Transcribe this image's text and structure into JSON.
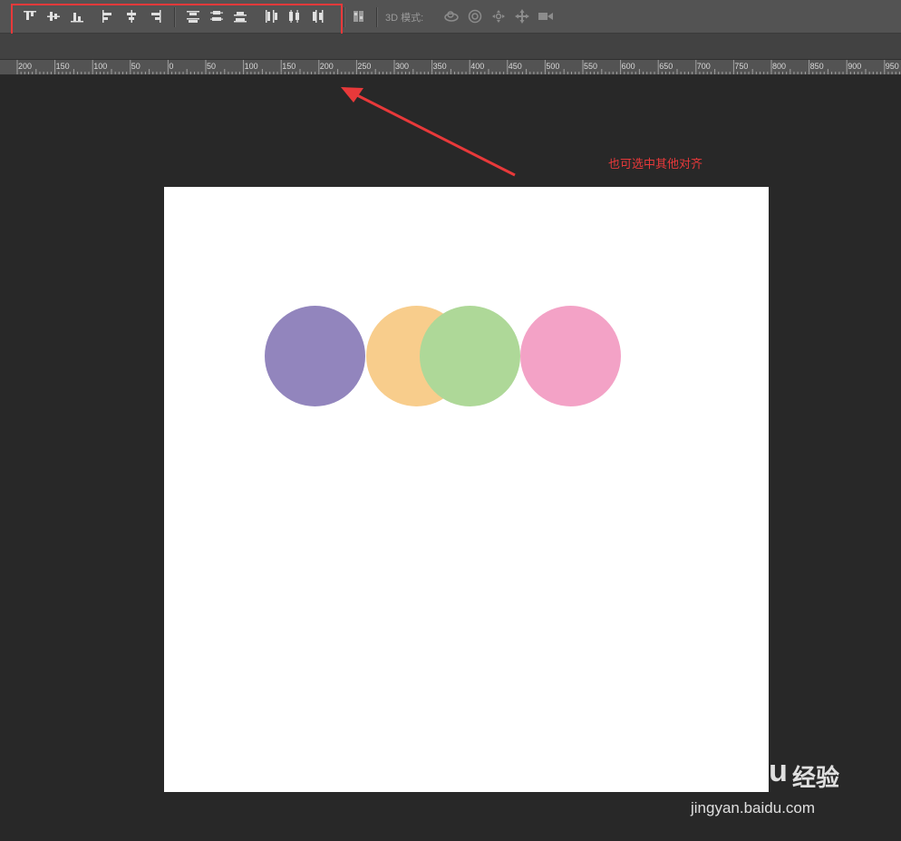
{
  "options_bar": {
    "align_buttons": [
      {
        "name": "align-top-edges-icon"
      },
      {
        "name": "align-vertical-centers-icon"
      },
      {
        "name": "align-bottom-edges-icon"
      },
      {
        "name": "align-left-edges-icon"
      },
      {
        "name": "align-horizontal-centers-icon"
      },
      {
        "name": "align-right-edges-icon"
      }
    ],
    "distribute_buttons": [
      {
        "name": "distribute-top-edges-icon"
      },
      {
        "name": "distribute-vertical-centers-icon"
      },
      {
        "name": "distribute-bottom-edges-icon"
      },
      {
        "name": "distribute-left-edges-icon"
      },
      {
        "name": "distribute-horizontal-centers-icon"
      },
      {
        "name": "distribute-right-edges-icon"
      }
    ],
    "auto_align_icon": "auto-align-layers-icon",
    "mode_label": "3D 模式:",
    "mode_icons": [
      "orbit-3d-icon",
      "roll-3d-icon",
      "pan-3d-icon",
      "slide-3d-icon",
      "scale-3d-camera-icon"
    ]
  },
  "ruler": {
    "labels": [
      "200",
      "150",
      "100",
      "50",
      "0",
      "50",
      "100",
      "150",
      "200",
      "250",
      "300",
      "350",
      "400",
      "450",
      "500",
      "550",
      "600",
      "650",
      "700",
      "750",
      "800",
      "850",
      "900",
      "950"
    ]
  },
  "canvas": {
    "background": "#ffffff",
    "circles": [
      {
        "name": "purple-circle",
        "color": "#9285bd"
      },
      {
        "name": "orange-circle",
        "color": "#f8cd8c"
      },
      {
        "name": "green-circle",
        "color": "#aed898"
      },
      {
        "name": "pink-circle",
        "color": "#f3a2c6"
      }
    ]
  },
  "annotation": {
    "text": "也可选中其他对齐",
    "color": "#e8393a"
  },
  "watermark": {
    "brand": "Bai du",
    "cn": "经验",
    "url": "jingyan.baidu.com"
  }
}
